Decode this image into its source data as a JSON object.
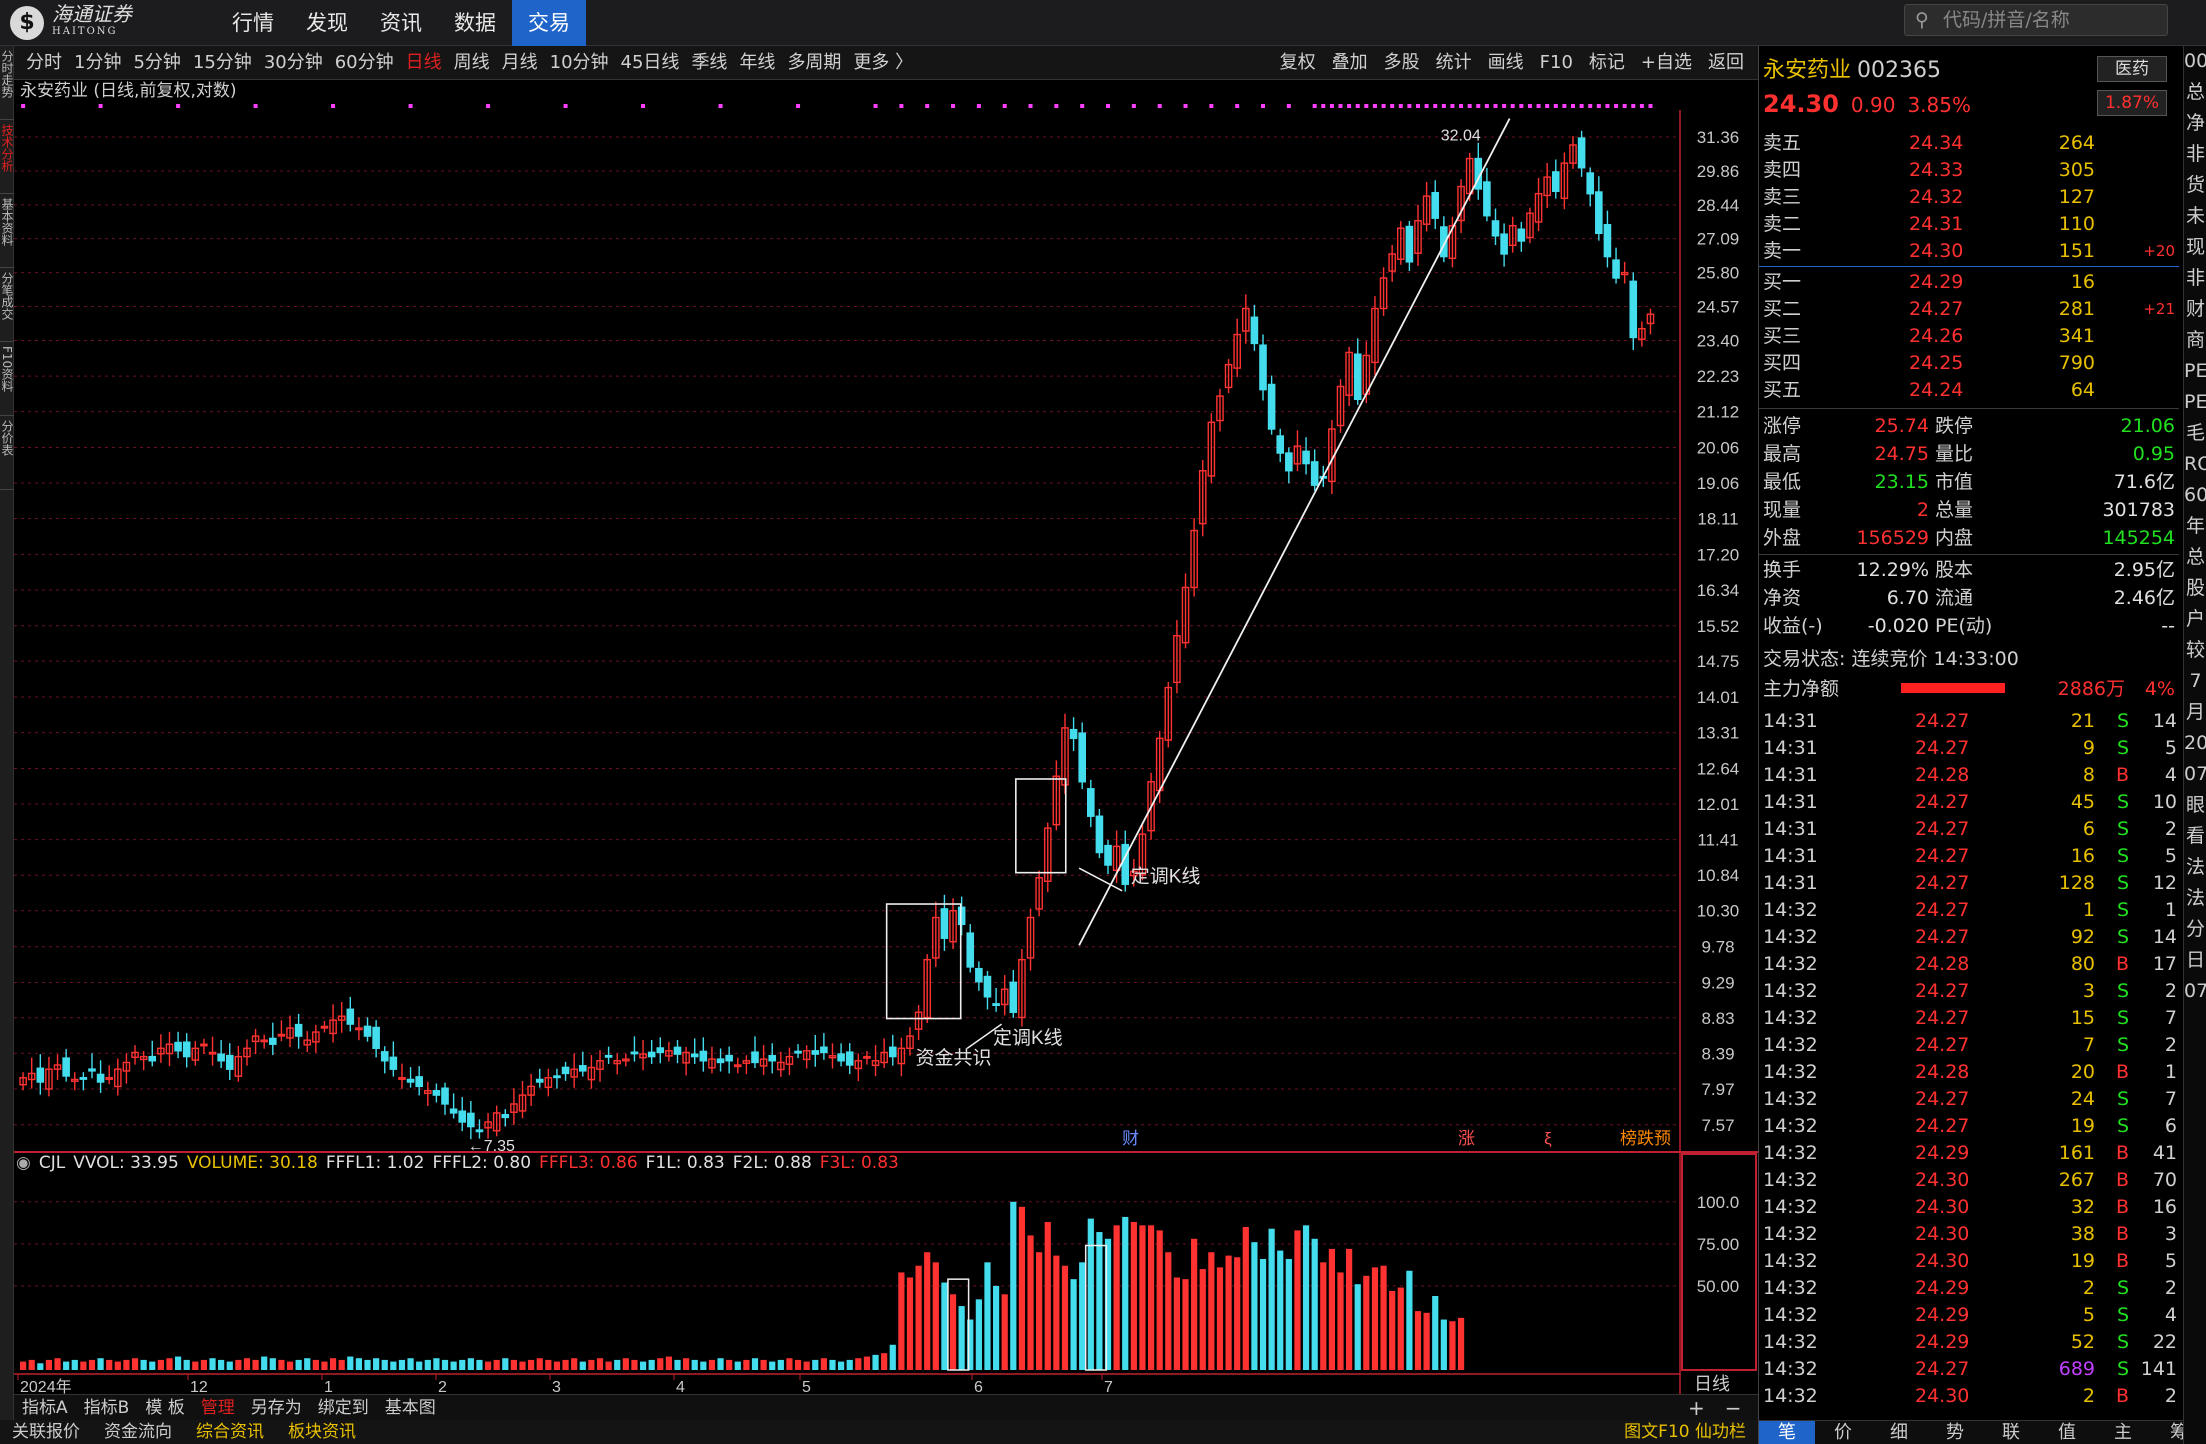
{
  "topbar": {
    "logo_main": "海通证券",
    "logo_sub": "HAITONG",
    "logo_glyph": "$",
    "menu": [
      "行情",
      "发现",
      "资讯",
      "数据",
      "交易"
    ],
    "active_menu": 4,
    "search_placeholder": "代码/拼音/名称",
    "search_icon": "search-icon"
  },
  "left_strip": [
    "分时走势",
    "技术分析",
    "基本资料",
    "分笔成交",
    "F10资料",
    "分价表"
  ],
  "period_bar": {
    "periods": [
      "分时",
      "1分钟",
      "5分钟",
      "15分钟",
      "30分钟",
      "60分钟",
      "日线",
      "周线",
      "月线",
      "10分钟",
      "45日线",
      "季线",
      "年线",
      "多周期",
      "更多 〉"
    ],
    "selected": 6,
    "tools": [
      "复权",
      "叠加",
      "多股",
      "统计",
      "画线",
      "F10",
      "标记",
      "+自选",
      "返回"
    ]
  },
  "chart_title": "永安药业 (日线,前复权,对数)",
  "chart_data": {
    "type": "candlestick",
    "title": "永安药业 (日线,前复权,对数)",
    "yscale": "log",
    "y_ticks": [
      31.36,
      29.86,
      28.44,
      27.09,
      25.8,
      24.57,
      23.4,
      22.23,
      21.12,
      20.06,
      19.06,
      18.11,
      17.2,
      16.34,
      15.52,
      14.75,
      14.01,
      13.31,
      12.64,
      12.01,
      11.41,
      10.84,
      10.3,
      9.78,
      9.29,
      8.83,
      8.39,
      7.97,
      7.57
    ],
    "x_labels": [
      "2024年",
      "12",
      "1",
      "2",
      "3",
      "4",
      "5",
      "6",
      "7"
    ],
    "ylim": [
      7.3,
      32.6
    ],
    "closes": [
      8.1,
      8.15,
      8.05,
      8.2,
      8.25,
      8.12,
      8.08,
      8.1,
      8.18,
      8.05,
      8.1,
      8.2,
      8.28,
      8.4,
      8.35,
      8.3,
      8.45,
      8.5,
      8.42,
      8.35,
      8.45,
      8.5,
      8.4,
      8.3,
      8.2,
      8.35,
      8.45,
      8.6,
      8.55,
      8.5,
      8.62,
      8.7,
      8.6,
      8.55,
      8.65,
      8.72,
      8.8,
      8.85,
      8.75,
      8.7,
      8.6,
      8.45,
      8.3,
      8.2,
      8.1,
      8.05,
      8.0,
      7.95,
      7.9,
      7.8,
      7.7,
      7.6,
      7.55,
      7.5,
      7.6,
      7.7,
      7.65,
      7.8,
      7.9,
      8.0,
      8.05,
      8.1,
      8.12,
      8.15,
      8.2,
      8.18,
      8.22,
      8.3,
      8.35,
      8.3,
      8.32,
      8.4,
      8.38,
      8.35,
      8.4,
      8.42,
      8.38,
      8.4,
      8.35,
      8.3,
      8.32,
      8.28,
      8.3,
      8.25,
      8.3,
      8.28,
      8.32,
      8.3,
      8.28,
      8.35,
      8.4,
      8.42,
      8.38,
      8.4,
      8.36,
      8.3,
      8.25,
      8.3,
      8.35,
      8.3,
      8.4,
      8.35,
      8.45,
      8.6,
      8.9,
      9.6,
      10.2,
      9.9,
      10.3,
      10.1,
      9.5,
      9.3,
      9.1,
      9.0,
      9.2,
      8.9,
      9.6,
      10.2,
      10.8,
      11.6,
      12.5,
      13.4,
      13.2,
      12.4,
      11.8,
      11.2,
      11.0,
      11.3,
      10.7,
      10.9,
      11.5,
      12.4,
      13.2,
      14.2,
      15.3,
      16.4,
      17.8,
      19.4,
      20.8,
      21.6,
      22.6,
      23.6,
      24.5,
      23.3,
      21.8,
      20.6,
      19.9,
      19.4,
      20.1,
      19.6,
      19.0,
      19.2,
      20.6,
      21.9,
      23.0,
      21.5,
      22.9,
      24.5,
      25.6,
      26.5,
      27.5,
      26.2,
      27.8,
      28.8,
      27.9,
      26.4,
      27.6,
      29.2,
      30.4,
      29.1,
      28.0,
      27.2,
      26.5,
      27.6,
      27.0,
      28.1,
      28.9,
      29.6,
      29.0,
      30.2,
      31.0,
      30.0,
      28.9,
      27.3,
      26.4,
      25.6,
      25.8,
      23.5,
      23.8,
      24.3
    ],
    "volumes": [
      5,
      6,
      4,
      6,
      7,
      5,
      6,
      5,
      6,
      7,
      6,
      5,
      6,
      7,
      6,
      5,
      6,
      7,
      8,
      6,
      5,
      6,
      7,
      6,
      5,
      6,
      7,
      6,
      8,
      7,
      6,
      5,
      6,
      7,
      6,
      5,
      7,
      6,
      8,
      7,
      6,
      7,
      6,
      5,
      6,
      7,
      5,
      6,
      7,
      6,
      5,
      6,
      7,
      6,
      5,
      6,
      7,
      6,
      5,
      6,
      7,
      6,
      5,
      6,
      7,
      5,
      6,
      7,
      5,
      6,
      7,
      6,
      5,
      6,
      7,
      8,
      6,
      7,
      6,
      5,
      6,
      7,
      6,
      5,
      6,
      7,
      6,
      5,
      6,
      7,
      6,
      5,
      6,
      7,
      6,
      5,
      6,
      7,
      8,
      9,
      10,
      15,
      58,
      55,
      62,
      70,
      64,
      52,
      45,
      38,
      30,
      42,
      64,
      50,
      45,
      100,
      97,
      80,
      70,
      88,
      68,
      62,
      54,
      64,
      90,
      82,
      78,
      86,
      91,
      88,
      86,
      86,
      83,
      70,
      55,
      54,
      78,
      60,
      70,
      61,
      68,
      67,
      85,
      76,
      66,
      84,
      71,
      66,
      83,
      86,
      78,
      64,
      72,
      58,
      72,
      51,
      56,
      61,
      62,
      47,
      49,
      59,
      35,
      34,
      44,
      30,
      29,
      31
    ],
    "annotations": [
      "资金共识",
      "定调K线",
      "定调K线",
      "32.04",
      "7.35",
      "财",
      "涨",
      "ξ",
      "榜跌预"
    ]
  },
  "vol_indicator": {
    "name": "CJL",
    "items": [
      {
        "t": "VVOL: 33.95",
        "c": "#e0e0e0"
      },
      {
        "t": "VOLUME: 30.18",
        "c": "#e8c000"
      },
      {
        "t": "FFFL1: 1.02",
        "c": "#e0e0e0"
      },
      {
        "t": "FFFL2: 0.80",
        "c": "#e0e0e0"
      },
      {
        "t": "FFFL3: 0.86",
        "c": "#ff3030"
      },
      {
        "t": "F1L: 0.83",
        "c": "#e0e0e0"
      },
      {
        "t": "F2L: 0.88",
        "c": "#e0e0e0"
      },
      {
        "t": "F3L: 0.83",
        "c": "#ff3030"
      }
    ],
    "ticks": [
      "100.0",
      "75.00",
      "50.00"
    ]
  },
  "period_label": "日线",
  "zoom": [
    "+",
    "−"
  ],
  "bottom_tabs": [
    "指标A",
    "指标B",
    "模 板",
    "管理",
    "另存为",
    "绑定到",
    "基本图"
  ],
  "bottom_selected": 3,
  "status": {
    "items": [
      "关联报价",
      "资金流向",
      "综合资讯",
      "板块资讯"
    ],
    "highlight": [
      2,
      3
    ],
    "right": "图文F10  仙功栏"
  },
  "quote": {
    "name": "永安药业",
    "code": "002365",
    "price": "24.30",
    "change": "0.90",
    "pct": "3.85%",
    "industry": "医药",
    "industry_pct": "1.87%",
    "asks": [
      {
        "l": "卖五",
        "p": "24.34",
        "v": "264",
        "c": ""
      },
      {
        "l": "卖四",
        "p": "24.33",
        "v": "305",
        "c": ""
      },
      {
        "l": "卖三",
        "p": "24.32",
        "v": "127",
        "c": ""
      },
      {
        "l": "卖二",
        "p": "24.31",
        "v": "110",
        "c": ""
      },
      {
        "l": "卖一",
        "p": "24.30",
        "v": "151",
        "c": "+20"
      }
    ],
    "bids": [
      {
        "l": "买一",
        "p": "24.29",
        "v": "16",
        "c": ""
      },
      {
        "l": "买二",
        "p": "24.27",
        "v": "281",
        "c": "+21"
      },
      {
        "l": "买三",
        "p": "24.26",
        "v": "341",
        "c": ""
      },
      {
        "l": "买四",
        "p": "24.25",
        "v": "790",
        "c": ""
      },
      {
        "l": "买五",
        "p": "24.24",
        "v": "64",
        "c": ""
      }
    ],
    "stats1": [
      {
        "l1": "涨停",
        "v1": "25.74",
        "c1": "red",
        "l2": "跌停",
        "v2": "21.06",
        "c2": "grn"
      },
      {
        "l1": "最高",
        "v1": "24.75",
        "c1": "red",
        "l2": "量比",
        "v2": "0.95",
        "c2": "grn"
      },
      {
        "l1": "最低",
        "v1": "23.15",
        "c1": "grn",
        "l2": "市值",
        "v2": "71.6亿",
        "c2": "wht"
      },
      {
        "l1": "现量",
        "v1": "2",
        "c1": "red",
        "l2": "总量",
        "v2": "301783",
        "c2": "wht"
      },
      {
        "l1": "外盘",
        "v1": "156529",
        "c1": "red",
        "l2": "内盘",
        "v2": "145254",
        "c2": "grn"
      }
    ],
    "stats2": [
      {
        "l1": "换手",
        "v1": "12.29%",
        "c1": "wht",
        "l2": "股本",
        "v2": "2.95亿",
        "c2": "wht"
      },
      {
        "l1": "净资",
        "v1": "6.70",
        "c1": "wht",
        "l2": "流通",
        "v2": "2.46亿",
        "c2": "wht"
      },
      {
        "l1": "收益(-)",
        "v1": "-0.020",
        "c1": "wht",
        "l2": "PE(动)",
        "v2": "--",
        "c2": "wht"
      }
    ],
    "trade_state": "交易状态: 连续竞价 14:33:00",
    "main_force": {
      "label": "主力净额",
      "amount": "2886万",
      "pct": "4%"
    },
    "ticks": [
      [
        "14:31",
        "24.27",
        "21",
        "S",
        "14"
      ],
      [
        "14:31",
        "24.27",
        "9",
        "S",
        "5"
      ],
      [
        "14:31",
        "24.28",
        "8",
        "B",
        "4"
      ],
      [
        "14:31",
        "24.27",
        "45",
        "S",
        "10"
      ],
      [
        "14:31",
        "24.27",
        "6",
        "S",
        "2"
      ],
      [
        "14:31",
        "24.27",
        "16",
        "S",
        "5"
      ],
      [
        "14:31",
        "24.27",
        "128",
        "S",
        "12"
      ],
      [
        "14:32",
        "24.27",
        "1",
        "S",
        "1"
      ],
      [
        "14:32",
        "24.27",
        "92",
        "S",
        "14"
      ],
      [
        "14:32",
        "24.28",
        "80",
        "B",
        "17"
      ],
      [
        "14:32",
        "24.27",
        "3",
        "S",
        "2"
      ],
      [
        "14:32",
        "24.27",
        "15",
        "S",
        "7"
      ],
      [
        "14:32",
        "24.27",
        "7",
        "S",
        "2"
      ],
      [
        "14:32",
        "24.28",
        "20",
        "B",
        "1"
      ],
      [
        "14:32",
        "24.27",
        "24",
        "S",
        "7"
      ],
      [
        "14:32",
        "24.27",
        "19",
        "S",
        "6"
      ],
      [
        "14:32",
        "24.29",
        "161",
        "B",
        "41"
      ],
      [
        "14:32",
        "24.30",
        "267",
        "B",
        "70"
      ],
      [
        "14:32",
        "24.30",
        "32",
        "B",
        "16"
      ],
      [
        "14:32",
        "24.30",
        "38",
        "B",
        "3"
      ],
      [
        "14:32",
        "24.30",
        "19",
        "B",
        "5"
      ],
      [
        "14:32",
        "24.29",
        "2",
        "S",
        "2"
      ],
      [
        "14:32",
        "24.29",
        "5",
        "S",
        "4"
      ],
      [
        "14:32",
        "24.29",
        "52",
        "S",
        "22"
      ],
      [
        "14:32",
        "24.27",
        "689",
        "S",
        "141"
      ],
      [
        "14:32",
        "24.30",
        "2",
        "B",
        "2"
      ]
    ],
    "tabs": [
      "笔",
      "价",
      "细",
      "势",
      "联",
      "值",
      "主",
      "筹"
    ],
    "strip_chars": [
      "00",
      "",
      "",
      "",
      "",
      "总",
      "净",
      "非",
      "货",
      "未",
      "现",
      "非",
      "财",
      "商",
      "",
      "PE",
      "PE",
      "毛",
      "RO",
      "",
      "60",
      "年",
      "总",
      "",
      "股",
      "户",
      "较",
      "",
      "7月",
      "20",
      "07",
      "",
      "眼",
      "看",
      "",
      "",
      "法",
      "法",
      "分",
      "",
      "日",
      "07"
    ]
  }
}
